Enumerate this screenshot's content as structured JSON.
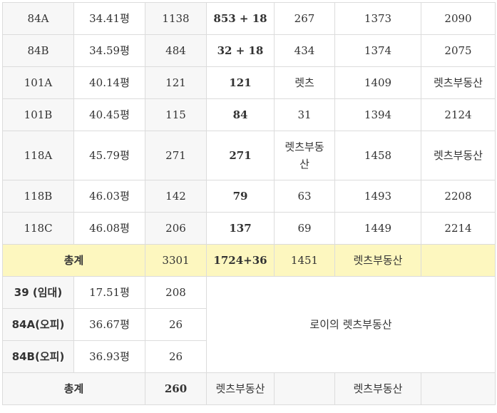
{
  "rows": [
    {
      "type": "84A",
      "area": "34.41평",
      "households": "1138",
      "supply": "853 + 18",
      "c5": "267",
      "c6": "1373",
      "c7": "2090"
    },
    {
      "type": "84B",
      "area": "34.59평",
      "households": "484",
      "supply": "32 + 18",
      "c5": "434",
      "c6": "1374",
      "c7": "2075"
    },
    {
      "type": "101A",
      "area": "40.14평",
      "households": "121",
      "supply": "121",
      "c5": "렛츠",
      "c6": "1409",
      "c7": "렛츠부동산"
    },
    {
      "type": "101B",
      "area": "40.45평",
      "households": "115",
      "supply": "84",
      "c5": "31",
      "c6": "1394",
      "c7": "2124"
    },
    {
      "type": "118A",
      "area": "45.79평",
      "households": "271",
      "supply": "271",
      "c5_line1": "렛츠부동",
      "c5_line2": "산",
      "c6": "1458",
      "c7": "렛츠부동산"
    },
    {
      "type": "118B",
      "area": "46.03평",
      "households": "142",
      "supply": "79",
      "c5": "63",
      "c6": "1493",
      "c7": "2208"
    },
    {
      "type": "118C",
      "area": "46.08평",
      "households": "206",
      "supply": "137",
      "c5": "69",
      "c6": "1449",
      "c7": "2214"
    }
  ],
  "total1": {
    "label": "총계",
    "households": "3301",
    "supply": "1724+36",
    "c5": "1451",
    "c6": "렛츠부동산",
    "c7": ""
  },
  "officetel": [
    {
      "type": "39 (임대)",
      "area": "17.51평",
      "households": "208"
    },
    {
      "type": "84A(오피)",
      "area": "36.67평",
      "households": "26"
    },
    {
      "type": "84B(오피)",
      "area": "36.93평",
      "households": "26"
    }
  ],
  "merged_note": "로이의 렛츠부동산",
  "total2": {
    "label": "총계",
    "households": "260",
    "supply": "렛츠부동산",
    "c5": "",
    "c6": "렛츠부동산",
    "c7": ""
  }
}
